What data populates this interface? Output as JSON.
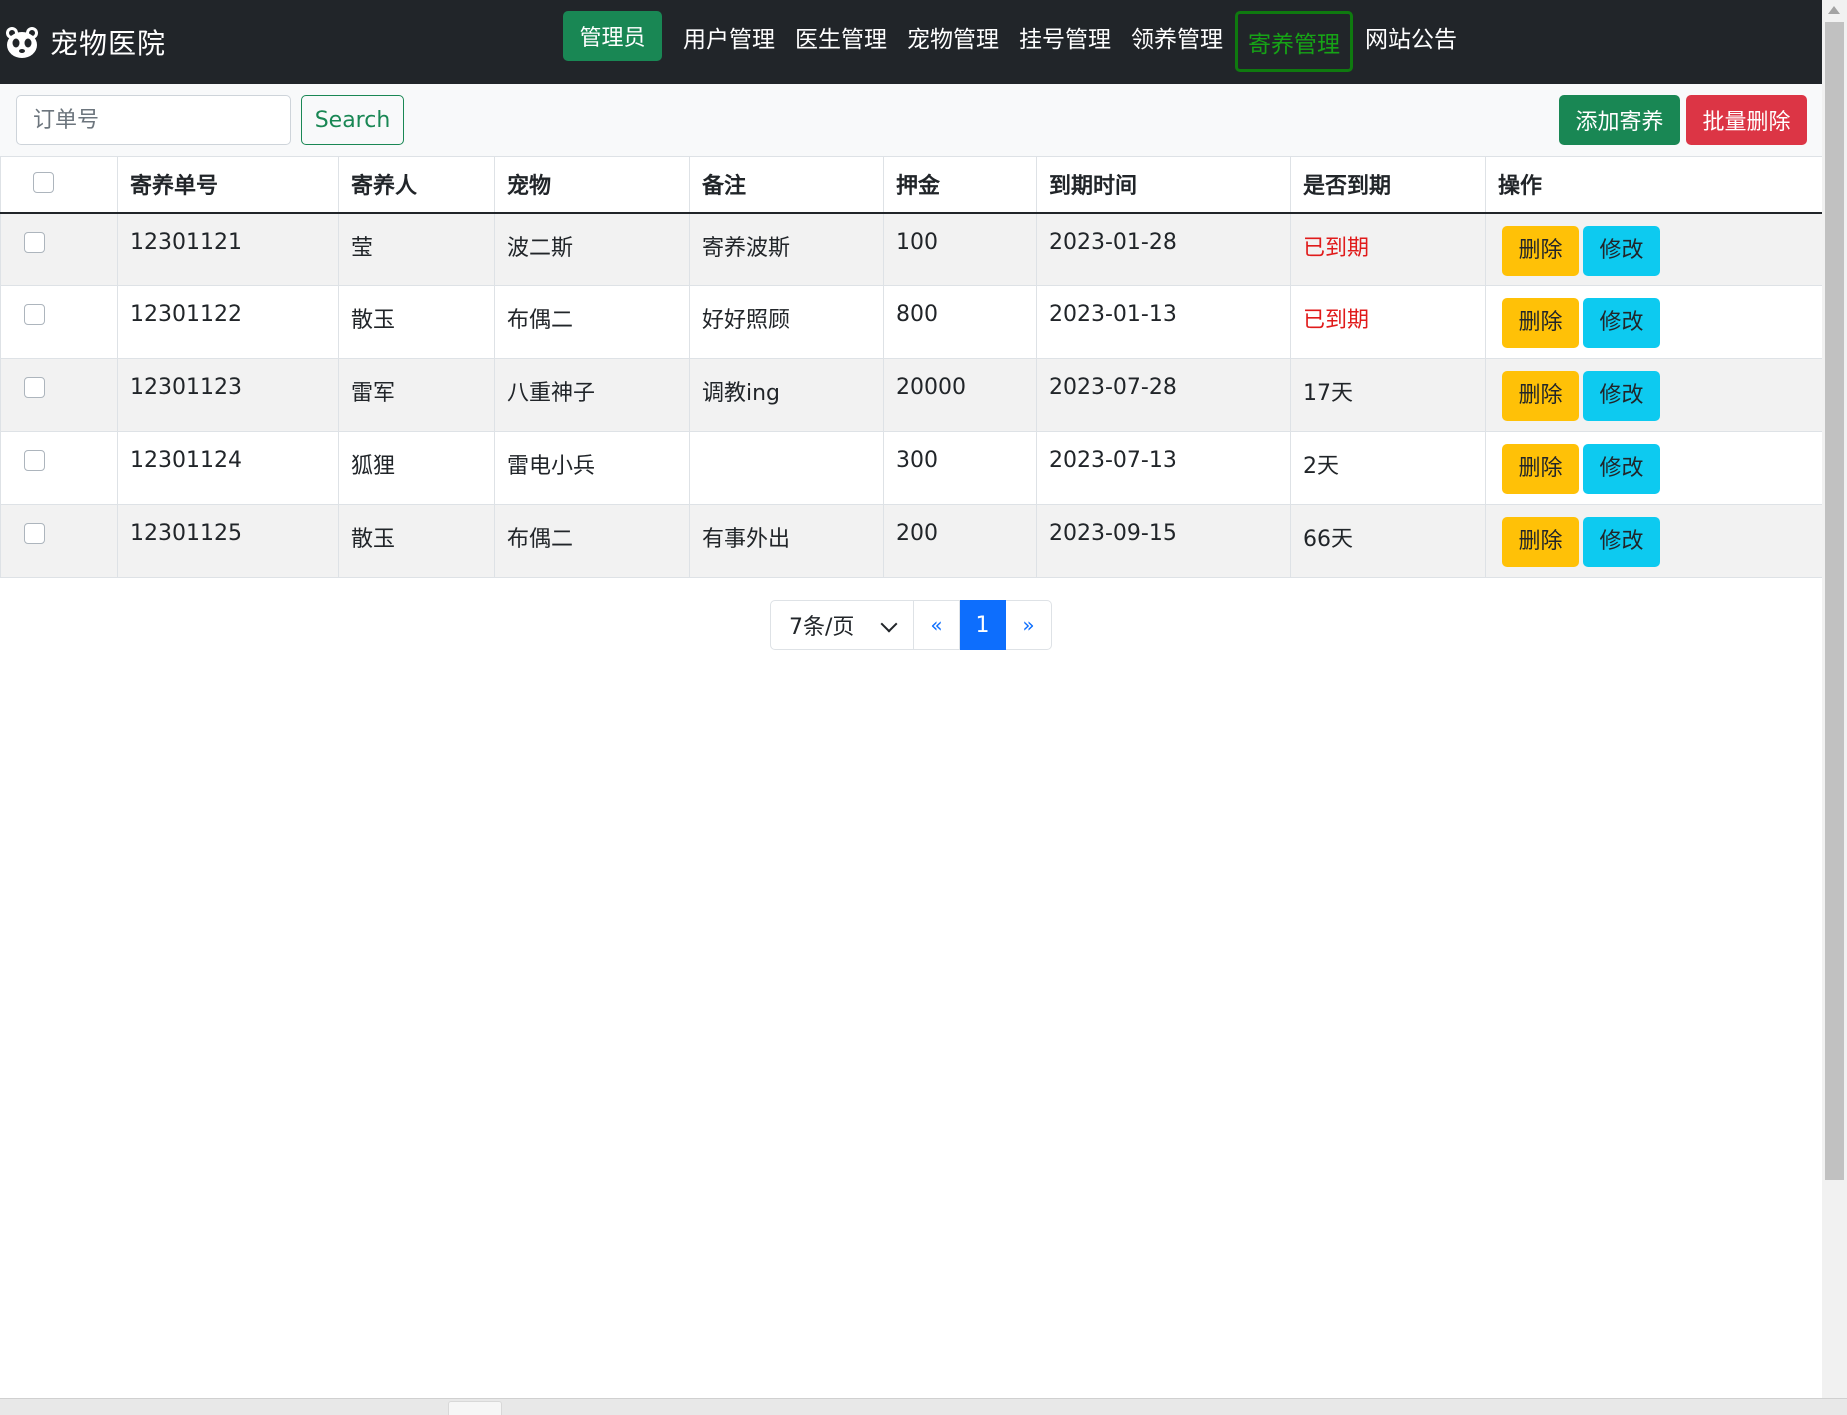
{
  "app": {
    "brand": "宠物医院"
  },
  "nav": {
    "role_badge": "管理员",
    "items": [
      {
        "label": "用户管理",
        "active": false
      },
      {
        "label": "医生管理",
        "active": false
      },
      {
        "label": "宠物管理",
        "active": false
      },
      {
        "label": "挂号管理",
        "active": false
      },
      {
        "label": "领养管理",
        "active": false
      },
      {
        "label": "寄养管理",
        "active": true
      },
      {
        "label": "网站公告",
        "active": false
      }
    ]
  },
  "toolbar": {
    "search_placeholder": "订单号",
    "search_value": "",
    "search_label": "Search",
    "add_label": "添加寄养",
    "bulk_delete_label": "批量删除"
  },
  "table": {
    "headers": [
      "寄养单号",
      "寄养人",
      "宠物",
      "备注",
      "押金",
      "到期时间",
      "是否到期",
      "操作"
    ],
    "rows": [
      {
        "id": "12301121",
        "owner": "莹",
        "pet": "波二斯",
        "note": "寄养波斯",
        "deposit": "100",
        "due": "2023-01-28",
        "status": "已到期",
        "expired": true
      },
      {
        "id": "12301122",
        "owner": "散玉",
        "pet": "布偶二",
        "note": "好好照顾",
        "deposit": "800",
        "due": "2023-01-13",
        "status": "已到期",
        "expired": true
      },
      {
        "id": "12301123",
        "owner": "雷军",
        "pet": "八重神子",
        "note": "调教ing",
        "deposit": "20000",
        "due": "2023-07-28",
        "status": "17天",
        "expired": false
      },
      {
        "id": "12301124",
        "owner": "狐狸",
        "pet": "雷电小兵",
        "note": "",
        "deposit": "300",
        "due": "2023-07-13",
        "status": "2天",
        "expired": false
      },
      {
        "id": "12301125",
        "owner": "散玉",
        "pet": "布偶二",
        "note": "有事外出",
        "deposit": "200",
        "due": "2023-09-15",
        "status": "66天",
        "expired": false
      }
    ],
    "delete_label": "删除",
    "edit_label": "修改"
  },
  "pagination": {
    "page_size": "7条/页",
    "prev": "«",
    "current": "1",
    "next": "»"
  },
  "colors": {
    "navbar": "#212529",
    "success": "#198754",
    "danger": "#dc3545",
    "warning": "#ffc107",
    "info": "#0dcaf0",
    "primary": "#0d6efd",
    "expired_text": "#e01b1b"
  }
}
